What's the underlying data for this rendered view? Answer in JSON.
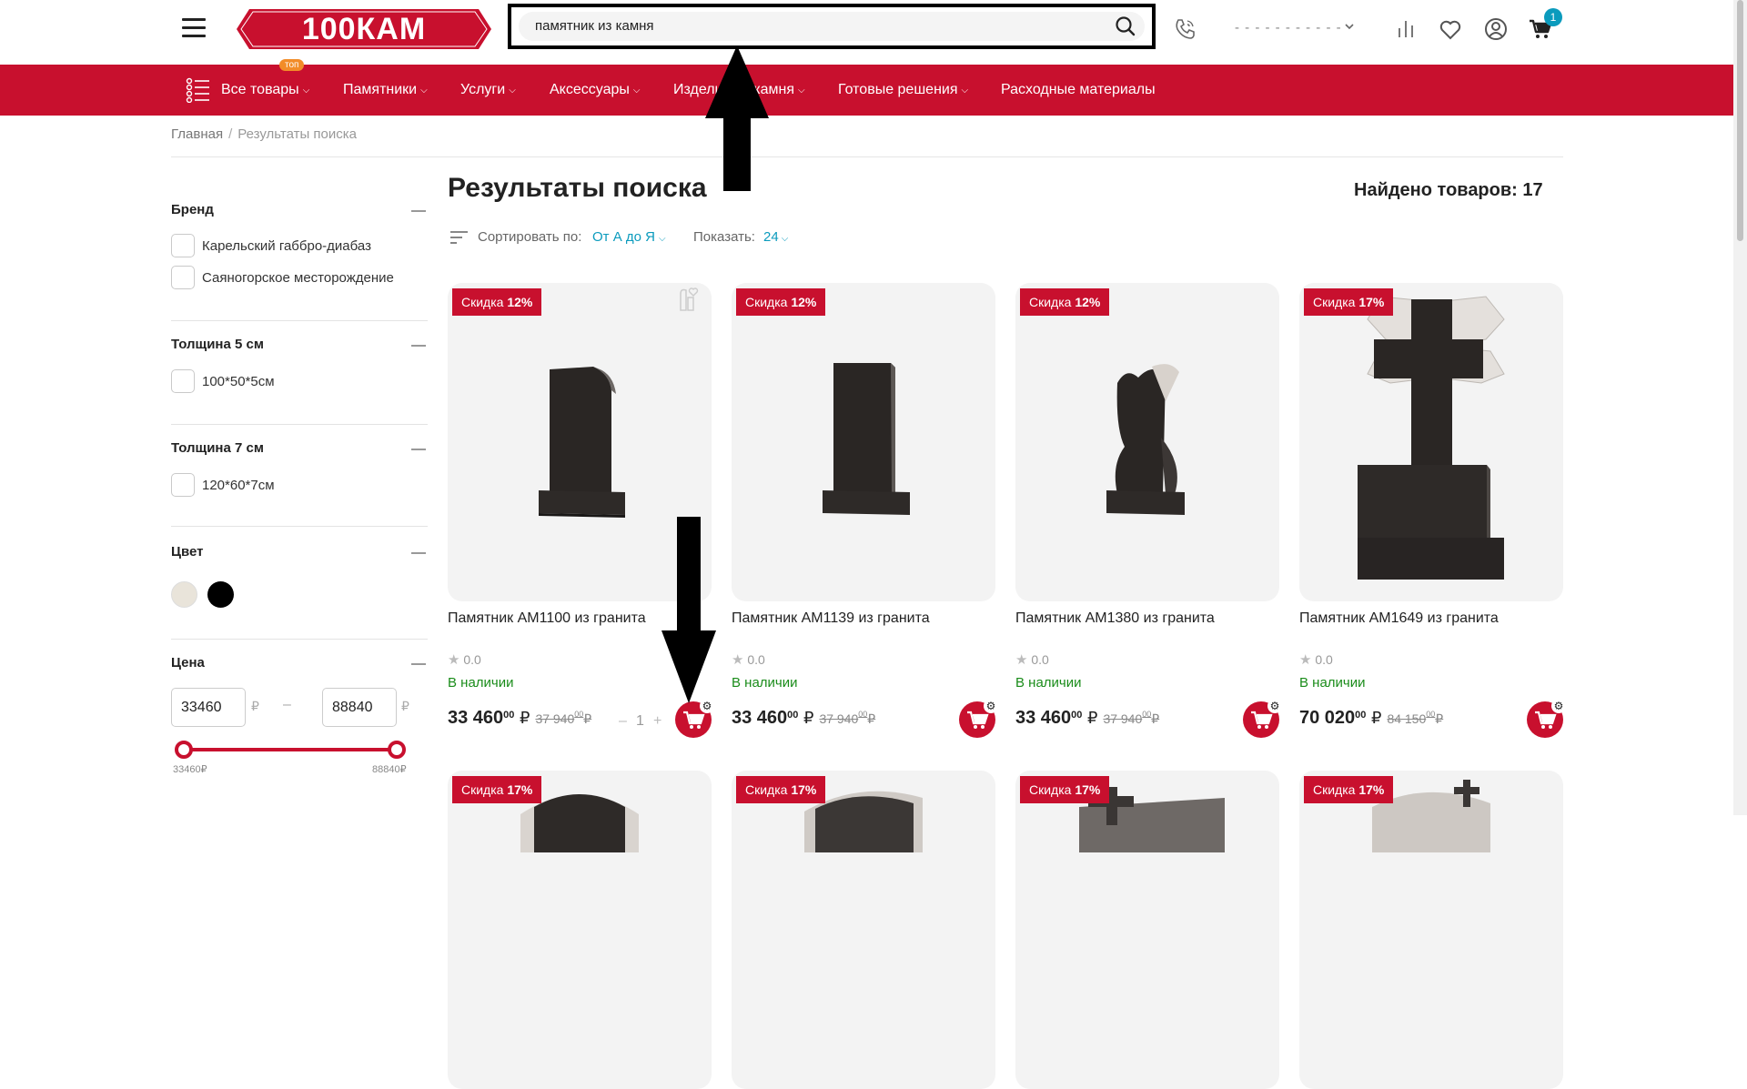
{
  "logo": {
    "text": "100КАМ"
  },
  "search": {
    "value": "памятник из камня"
  },
  "header": {
    "phone": "- - - - - - - - - - -",
    "cart_count": "1"
  },
  "nav": {
    "top_badge": "топ",
    "items": [
      {
        "label": "Все товары",
        "chevron": true
      },
      {
        "label": "Памятники",
        "chevron": true
      },
      {
        "label": "Услуги",
        "chevron": true
      },
      {
        "label": "Аксессуары",
        "chevron": true
      },
      {
        "label": "Изделия из камня",
        "chevron": true
      },
      {
        "label": "Готовые решения",
        "chevron": true
      },
      {
        "label": "Расходные материалы",
        "chevron": false
      }
    ]
  },
  "breadcrumb": {
    "home": "Главная",
    "separator": "/",
    "current": "Результаты поиска"
  },
  "page": {
    "title": "Результаты поиска",
    "found": "Найдено товаров: 17"
  },
  "sort": {
    "label": "Сортировать по:",
    "value": "От А до Я",
    "show_label": "Показать:",
    "show_value": "24"
  },
  "filters": {
    "brand": {
      "title": "Бренд",
      "options": [
        "Карельский габбро-диабаз",
        "Саяногорское месторождение"
      ]
    },
    "thick5": {
      "title": "Толщина 5 см",
      "options": [
        "100*50*5см"
      ]
    },
    "thick7": {
      "title": "Толщина 7 см",
      "options": [
        "120*60*7см"
      ]
    },
    "color": {
      "title": "Цвет",
      "swatches": [
        "#e9e4da",
        "#000000"
      ]
    },
    "price": {
      "title": "Цена",
      "min": "33460",
      "max": "88840",
      "currency": "₽",
      "dash": "–",
      "min_label": "33460₽",
      "max_label": "88840₽"
    }
  },
  "products": [
    {
      "discount_label": "Скидка",
      "discount": "12%",
      "name": "Памятник АМ1100 из гранита",
      "rating": "0.0",
      "stock": "В наличии",
      "price": "33 460",
      "price_kop": "00",
      "currency": "₽",
      "old_price": "37 940",
      "old_kop": "00",
      "old_currency": "₽",
      "qty_minus": "–",
      "qty": "1",
      "qty_plus": "+"
    },
    {
      "discount_label": "Скидка",
      "discount": "12%",
      "name": "Памятник АМ1139 из гранита",
      "rating": "0.0",
      "stock": "В наличии",
      "price": "33 460",
      "price_kop": "00",
      "currency": "₽",
      "old_price": "37 940",
      "old_kop": "00",
      "old_currency": "₽"
    },
    {
      "discount_label": "Скидка",
      "discount": "12%",
      "name": "Памятник АМ1380 из гранита",
      "rating": "0.0",
      "stock": "В наличии",
      "price": "33 460",
      "price_kop": "00",
      "currency": "₽",
      "old_price": "37 940",
      "old_kop": "00",
      "old_currency": "₽"
    },
    {
      "discount_label": "Скидка",
      "discount": "17%",
      "name": "Памятник АМ1649 из гранита",
      "rating": "0.0",
      "stock": "В наличии",
      "price": "70 020",
      "price_kop": "00",
      "currency": "₽",
      "old_price": "84 150",
      "old_kop": "00",
      "old_currency": "₽"
    }
  ],
  "products_row2": [
    {
      "discount_label": "Скидка",
      "discount": "17%"
    },
    {
      "discount_label": "Скидка",
      "discount": "17%"
    },
    {
      "discount_label": "Скидка",
      "discount": "17%"
    },
    {
      "discount_label": "Скидка",
      "discount": "17%"
    }
  ],
  "colors": {
    "brand_red": "#c8102e",
    "accent_teal": "#0b9bbd",
    "in_stock_green": "#1a8c1a"
  }
}
